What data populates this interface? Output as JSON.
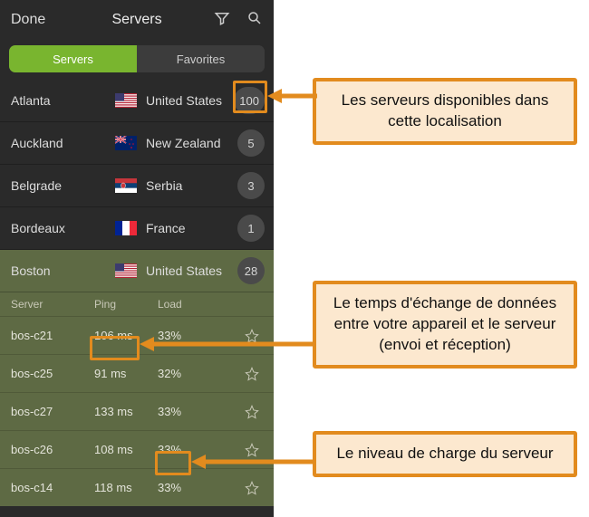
{
  "header": {
    "done": "Done",
    "title": "Servers"
  },
  "tabs": {
    "servers": "Servers",
    "favorites": "Favorites"
  },
  "cities": [
    {
      "city": "Atlanta",
      "country": "United States",
      "flag": "us",
      "count": "100"
    },
    {
      "city": "Auckland",
      "country": "New Zealand",
      "flag": "nz",
      "count": "5"
    },
    {
      "city": "Belgrade",
      "country": "Serbia",
      "flag": "rs",
      "count": "3"
    },
    {
      "city": "Bordeaux",
      "country": "France",
      "flag": "fr",
      "count": "1"
    },
    {
      "city": "Boston",
      "country": "United States",
      "flag": "us",
      "count": "28",
      "expanded": true
    }
  ],
  "server_table": {
    "headers": {
      "server": "Server",
      "ping": "Ping",
      "load": "Load"
    },
    "rows": [
      {
        "name": "bos-c21",
        "ping": "106 ms",
        "load": "33%"
      },
      {
        "name": "bos-c25",
        "ping": "91 ms",
        "load": "32%"
      },
      {
        "name": "bos-c27",
        "ping": "133 ms",
        "load": "33%"
      },
      {
        "name": "bos-c26",
        "ping": "108 ms",
        "load": "33%"
      },
      {
        "name": "bos-c14",
        "ping": "118 ms",
        "load": "33%"
      }
    ]
  },
  "callouts": {
    "available": "Les serveurs disponibles dans cette localisation",
    "ping": "Le temps d'échange de données entre votre appareil et le serveur (envoi et réception)",
    "load": "Le niveau de charge du serveur"
  }
}
